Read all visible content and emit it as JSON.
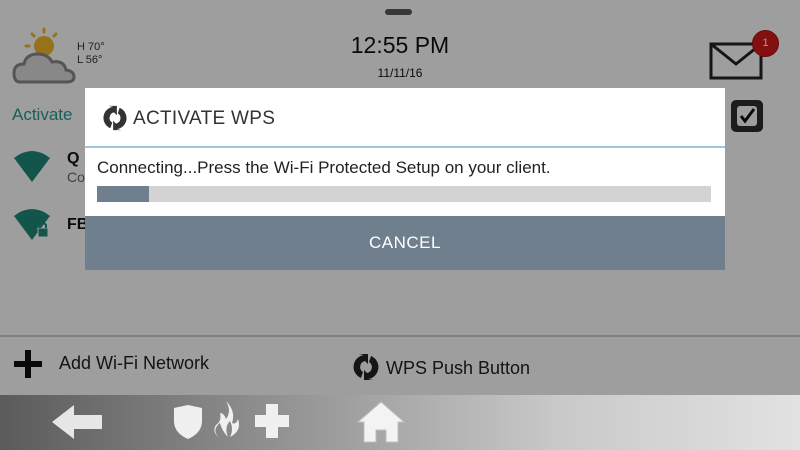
{
  "status_bar": {
    "weather": {
      "high": "H 70°",
      "low": "L 56°",
      "icon": "partly-cloudy-icon"
    },
    "time": "12:55 PM",
    "date": "11/11/16",
    "messages": {
      "count": "1",
      "icon": "envelope-icon"
    }
  },
  "settings": {
    "activate_label": "Activate",
    "checkbox_checked": true
  },
  "networks": [
    {
      "name": "Q",
      "sub": "Co",
      "secured": false
    },
    {
      "name": "FB",
      "sub": "",
      "secured": true
    }
  ],
  "actions": {
    "add_network": "Add Wi-Fi Network",
    "wps_push": "WPS Push Button"
  },
  "nav": {
    "items": [
      "back-arrow-icon",
      "security-shield-icon",
      "fire-icon",
      "medical-cross-icon",
      "home-icon"
    ]
  },
  "dialog": {
    "title": "ACTIVATE WPS",
    "message": "Connecting...Press the Wi-Fi Protected Setup on your client.",
    "progress_fraction": 0.085,
    "cancel_label": "CANCEL"
  },
  "colors": {
    "accent_teal": "#2a9a92",
    "button_slate": "#6f7f8e",
    "badge_red": "#d41a1a",
    "divider_blue": "#9bc9d9"
  }
}
